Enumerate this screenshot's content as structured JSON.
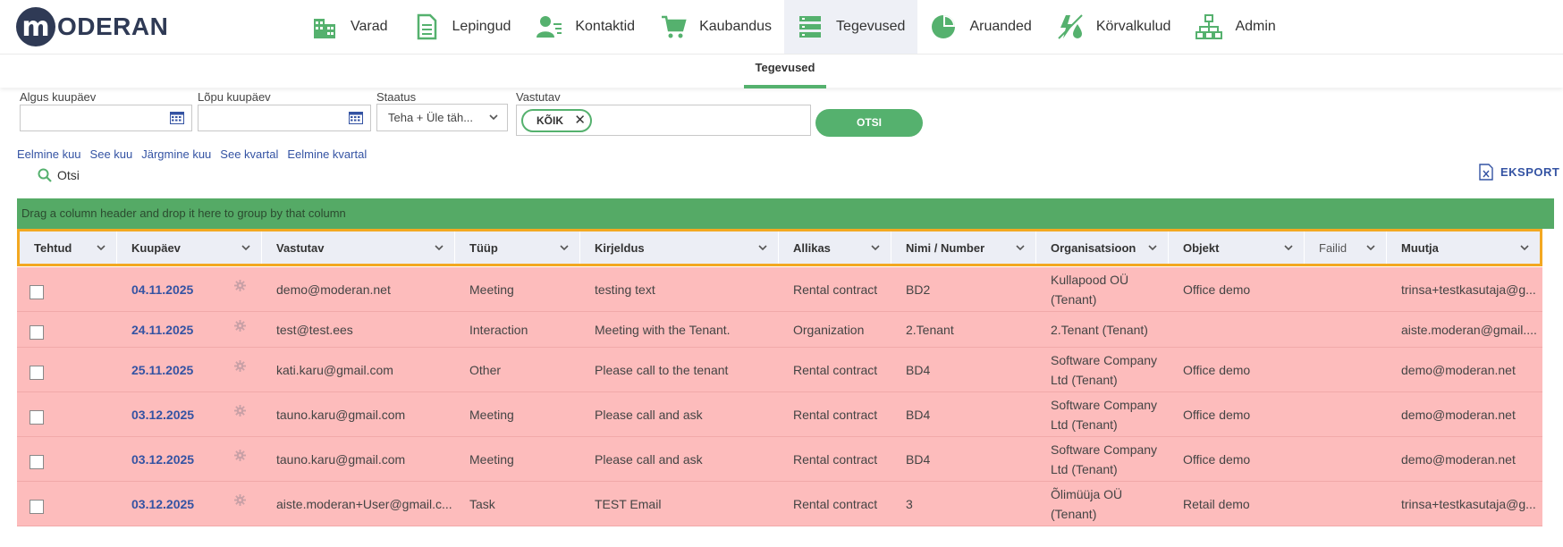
{
  "logo": {
    "letter": "m",
    "text": "ODERAN"
  },
  "nav": [
    {
      "label": "Varad",
      "icon": "buildings-icon"
    },
    {
      "label": "Lepingud",
      "icon": "document-icon"
    },
    {
      "label": "Kontaktid",
      "icon": "contact-icon"
    },
    {
      "label": "Kaubandus",
      "icon": "cart-icon"
    },
    {
      "label": "Tegevused",
      "icon": "tasks-icon",
      "active": true
    },
    {
      "label": "Aruanded",
      "icon": "pie-chart-icon"
    },
    {
      "label": "Körvalkulud",
      "icon": "utilities-icon"
    },
    {
      "label": "Admin",
      "icon": "hierarchy-icon"
    }
  ],
  "subnav": {
    "tab": "Tegevused"
  },
  "filters": {
    "start_label": "Algus kuupäev",
    "end_label": "Lõpu kuupäev",
    "status_label": "Staatus",
    "status_value": "Teha + Üle täh...",
    "responsible_label": "Vastutav",
    "responsible_tag": "KÕIK",
    "search_button": "OTSI"
  },
  "quick_links": [
    "Eelmine kuu",
    "See kuu",
    "Järgmine kuu",
    "See kvartal",
    "Eelmine kvartal"
  ],
  "search_label": "Otsi",
  "export_label": "EKSPORT",
  "group_bar": "Drag a column header and drop it here to group by that column",
  "columns": [
    "Tehtud",
    "Kuupäev",
    "Vastutav",
    "Tüüp",
    "Kirjeldus",
    "Allikas",
    "Nimi / Number",
    "Organisatsioon",
    "Objekt",
    "Failid",
    "Muutja"
  ],
  "rows": [
    {
      "date": "04.11.2025",
      "responsible": "demo@moderan.net",
      "type": "Meeting",
      "desc": "testing text",
      "source": "Rental contract",
      "name": "BD2",
      "org": "Kullapood OÜ (Tenant)",
      "object": "Office demo",
      "files": "",
      "modifier": "trinsa+testkasutaja@g..."
    },
    {
      "date": "24.11.2025",
      "responsible": "test@test.ees",
      "type": "Interaction",
      "desc": "Meeting with the Tenant.",
      "source": "Organization",
      "name": "2.Tenant",
      "org": "2.Tenant (Tenant)",
      "object": "",
      "files": "",
      "modifier": "aiste.moderan@gmail...."
    },
    {
      "date": "25.11.2025",
      "responsible": "kati.karu@gmail.com",
      "type": "Other",
      "desc": "Please call to the tenant",
      "source": "Rental contract",
      "name": "BD4",
      "org": "Software Company Ltd (Tenant)",
      "object": "Office demo",
      "files": "",
      "modifier": "demo@moderan.net"
    },
    {
      "date": "03.12.2025",
      "responsible": "tauno.karu@gmail.com",
      "type": "Meeting",
      "desc": "Please call and ask",
      "source": "Rental contract",
      "name": "BD4",
      "org": "Software Company Ltd (Tenant)",
      "object": "Office demo",
      "files": "",
      "modifier": "demo@moderan.net"
    },
    {
      "date": "03.12.2025",
      "responsible": "tauno.karu@gmail.com",
      "type": "Meeting",
      "desc": "Please call and ask",
      "source": "Rental contract",
      "name": "BD4",
      "org": "Software Company Ltd (Tenant)",
      "object": "Office demo",
      "files": "",
      "modifier": "demo@moderan.net"
    },
    {
      "date": "03.12.2025",
      "responsible": "aiste.moderan+User@gmail.c...",
      "type": "Task",
      "desc": "TEST Email",
      "source": "Rental contract",
      "name": "3",
      "org": "Õlimüüja OÜ (Tenant)",
      "object": "Retail demo",
      "files": "",
      "modifier": "trinsa+testkasutaja@g..."
    }
  ],
  "colors": {
    "accent_green": "#55b16e",
    "row_overdue": "#fdbcbc",
    "header_highlight": "#f3a821",
    "link_blue": "#3453a3",
    "brand_navy": "#2f3a55"
  }
}
